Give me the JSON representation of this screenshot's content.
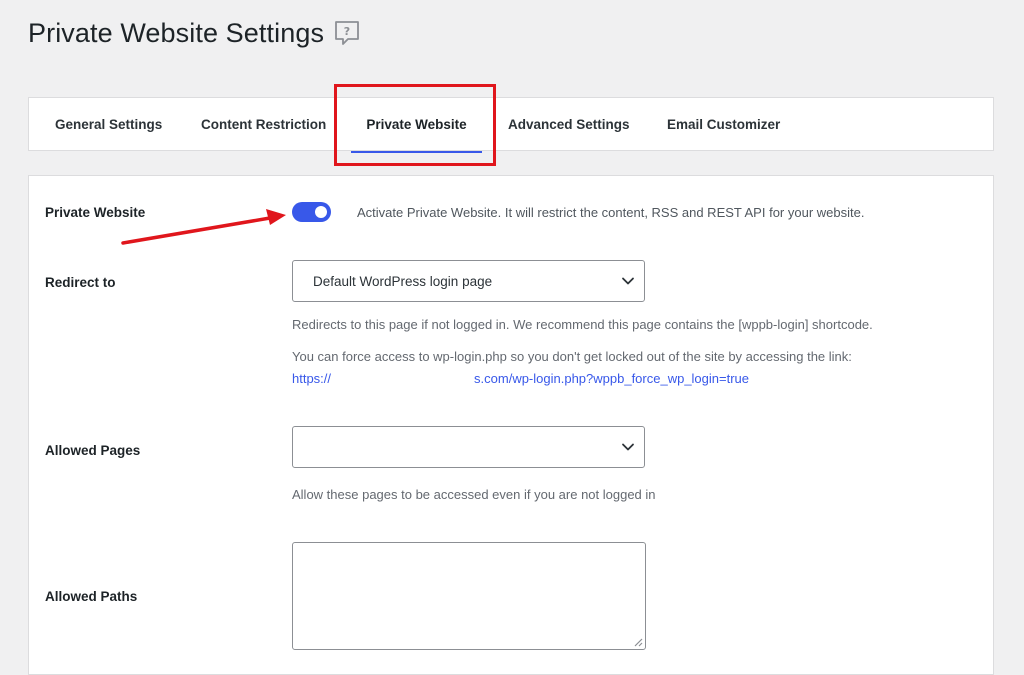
{
  "page": {
    "title": "Private Website Settings",
    "help_icon": "question-bubble-icon"
  },
  "tabs": [
    {
      "label": "General Settings",
      "active": false
    },
    {
      "label": "Content Restriction",
      "active": false
    },
    {
      "label": "Private Website",
      "active": true
    },
    {
      "label": "Advanced Settings",
      "active": false
    },
    {
      "label": "Email Customizer",
      "active": false
    }
  ],
  "settings": {
    "private_website": {
      "label": "Private Website",
      "enabled": true,
      "description": "Activate Private Website. It will restrict the content, RSS and REST API for your website."
    },
    "redirect_to": {
      "label": "Redirect to",
      "selected": "Default WordPress login page",
      "description": "Redirects to this page if not logged in. We recommend this page contains the [wppb-login] shortcode.",
      "force_access_text": "You can force access to wp-login.php so you don't get locked out of the site by accessing the link:",
      "link_prefix": "https://",
      "link_suffix": "s.com/wp-login.php?wppb_force_wp_login=true"
    },
    "allowed_pages": {
      "label": "Allowed Pages",
      "selected": "",
      "description": "Allow these pages to be accessed even if you are not logged in"
    },
    "allowed_paths": {
      "label": "Allowed Paths",
      "value": ""
    }
  },
  "annotations": {
    "highlight_color": "#e0161c",
    "accent_color": "#3858e9"
  }
}
